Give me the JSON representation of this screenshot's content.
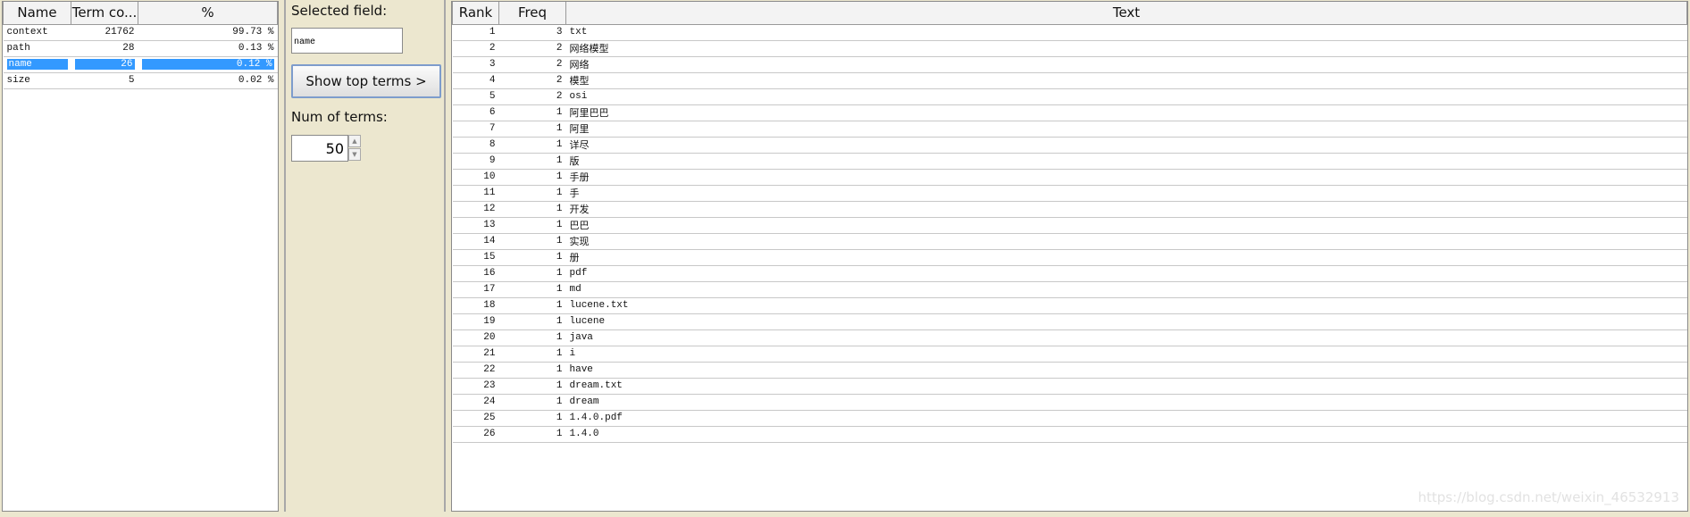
{
  "fields_table": {
    "headers": [
      "Name",
      "Term co...",
      "%"
    ],
    "rows": [
      {
        "name": "context",
        "count": "21762",
        "pct": "99.73 %"
      },
      {
        "name": "path",
        "count": "28",
        "pct": "0.13 %"
      },
      {
        "name": "name",
        "count": "26",
        "pct": "0.12 %",
        "selected": true
      },
      {
        "name": "size",
        "count": "5",
        "pct": "0.02 %"
      }
    ]
  },
  "controls": {
    "selected_field_label": "Selected field:",
    "selected_field_value": "name",
    "show_button": "Show top terms >",
    "num_terms_label": "Num of terms:",
    "num_terms_value": "50"
  },
  "terms_table": {
    "headers": [
      "Rank",
      "Freq",
      "Text"
    ],
    "rows": [
      [
        "1",
        "3",
        "txt"
      ],
      [
        "2",
        "2",
        "网络模型"
      ],
      [
        "3",
        "2",
        "网络"
      ],
      [
        "4",
        "2",
        "模型"
      ],
      [
        "5",
        "2",
        "osi"
      ],
      [
        "6",
        "1",
        "阿里巴巴"
      ],
      [
        "7",
        "1",
        "阿里"
      ],
      [
        "8",
        "1",
        "详尽"
      ],
      [
        "9",
        "1",
        "版"
      ],
      [
        "10",
        "1",
        "手册"
      ],
      [
        "11",
        "1",
        "手"
      ],
      [
        "12",
        "1",
        "开发"
      ],
      [
        "13",
        "1",
        "巴巴"
      ],
      [
        "14",
        "1",
        "实现"
      ],
      [
        "15",
        "1",
        "册"
      ],
      [
        "16",
        "1",
        "pdf"
      ],
      [
        "17",
        "1",
        "md"
      ],
      [
        "18",
        "1",
        "lucene.txt"
      ],
      [
        "19",
        "1",
        "lucene"
      ],
      [
        "20",
        "1",
        "java"
      ],
      [
        "21",
        "1",
        "i"
      ],
      [
        "22",
        "1",
        "have"
      ],
      [
        "23",
        "1",
        "dream.txt"
      ],
      [
        "24",
        "1",
        "dream"
      ],
      [
        "25",
        "1",
        "1.4.0.pdf"
      ],
      [
        "26",
        "1",
        "1.4.0"
      ]
    ]
  },
  "watermark": "https://blog.csdn.net/weixin_46532913",
  "colors": {
    "selection": "#3399ff",
    "background": "#ECE7CF"
  }
}
